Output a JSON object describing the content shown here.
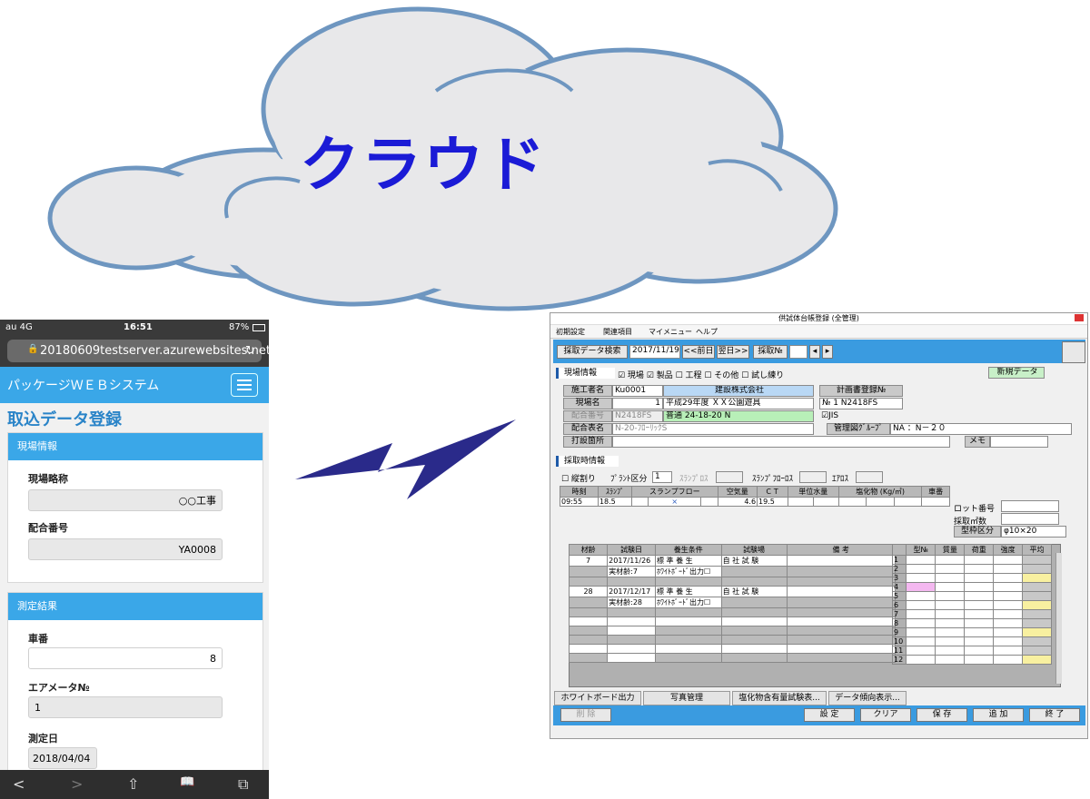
{
  "cloud": {
    "label": "クラウド"
  },
  "phone": {
    "status": {
      "carrier": "au 4G",
      "time": "16:51",
      "battery": "87%"
    },
    "url": "20180609testserver.azurewebsites.net",
    "nav_brand": "パッケージＷＥＢシステム",
    "page_title": "取込データ登録",
    "section1": {
      "header": "現場情報",
      "field1_label": "現場略称",
      "field1_value": "○○工事",
      "field2_label": "配合番号",
      "field2_value": "YA0008"
    },
    "section2": {
      "header": "測定結果",
      "field1_label": "車番",
      "field1_value": "8",
      "field2_label": "エアメータ№",
      "field2_value": "1",
      "field3_label": "測定日",
      "field3_value": "2018/04/04"
    },
    "bottom_bar": {
      "back": "<",
      "forward": ">",
      "share": "⇧",
      "bookmarks": "📖",
      "tabs": "⧉"
    }
  },
  "app": {
    "window_title": "供試体台帳登録 (全管理)",
    "menu": {
      "item1": "初期設定",
      "item2": "関連項目",
      "item3": "マイメニュー",
      "item4": "ヘルプ"
    },
    "toolbar": {
      "search_btn": "採取データ検索",
      "date": "2017/11/19",
      "prev": "<<前日",
      "next": "翌日>>",
      "sample_no": "採取№"
    },
    "site": {
      "header": "現場情報",
      "checks": "☑ 現場 ☑ 製品 ☐ 工程 ☐ その他 ☐ 試し練り",
      "new_badge": "新規データ",
      "contractor_lbl": "施工者名",
      "contractor_code": "Ku0001",
      "contractor_name": "建設株式会社",
      "plan_lbl": "計画書登録№",
      "plan_value": "№ 1 N2418FS",
      "site_lbl": "現場名",
      "site_no": "1",
      "site_name": "平成29年度 ＸＸ公園遊具",
      "mix_no_lbl": "配合番号",
      "mix_no": "N2418FS",
      "mix_spec": "普通 24-18-20 N",
      "jis": "☑JIS",
      "mix_table_lbl": "配合表名",
      "mix_table": "N-20-ﾌﾛｰﾘｯｸS",
      "group_lbl": "管理図ｸﾞﾙｰﾌﾟ",
      "group_value": "NA ：N－２０",
      "place_lbl": "打設箇所",
      "memo_lbl": "メモ"
    },
    "sampling": {
      "header": "採取時情報",
      "split": "☐ 縦割り",
      "plant_lbl": "ﾌﾟﾗﾝﾄ区分",
      "plant_value": "1",
      "slump_lbl": "ｽﾗﾝﾌﾟﾛｽ",
      "slumpflow_lbl": "ｽﾗﾝﾌﾟﾌﾛｰﾛｽ",
      "air_lbl": "ｴｱﾛｽ",
      "columns": [
        "時刻",
        "ｽﾗﾝﾌﾟ",
        "スランプフロー",
        "空気量",
        "ＣＴ",
        "単位水量",
        "塩化物 (Kg/㎥)",
        "車番"
      ],
      "row": [
        "09:55",
        "18.5",
        "×",
        "4.6",
        "19.5",
        "",
        "",
        ""
      ],
      "lot_lbl": "ロット番号",
      "count_lbl": "採取㎡数",
      "mold_lbl": "型枠区分",
      "mold_value": "φ10×20"
    },
    "test_table": {
      "columns": [
        "材齢",
        "試験日",
        "養生条件",
        "試験場",
        "備 考"
      ],
      "rows": [
        {
          "age": "7",
          "date": "2017/11/26",
          "cure": "標 準 養 生",
          "site": "自 社 試 験",
          "sub1": "実材齢:7",
          "sub2": "ﾎﾜｲﾄﾎﾞｰﾄﾞ出力☐"
        },
        {
          "age": "28",
          "date": "2017/12/17",
          "cure": "標 準 養 生",
          "site": "自 社 試 験",
          "sub1": "実材齢:28",
          "sub2": "ﾎﾜｲﾄﾎﾞｰﾄﾞ出力☐"
        }
      ],
      "right_columns": [
        "型№",
        "質量",
        "荷重",
        "強度",
        "平均"
      ],
      "row_numbers": [
        "1",
        "2",
        "3",
        "4",
        "5",
        "6",
        "7",
        "8",
        "9",
        "10",
        "11",
        "12"
      ]
    },
    "tabs": {
      "t1": "ホワイトボード出力",
      "t2": "写真管理",
      "t3": "塩化物含有量試験表...",
      "t4": "データ傾向表示..."
    },
    "footer": {
      "delete": "削 除",
      "settings": "設 定",
      "clear": "クリア",
      "save": "保 存",
      "add": "追 加",
      "exit": "終 了"
    }
  }
}
